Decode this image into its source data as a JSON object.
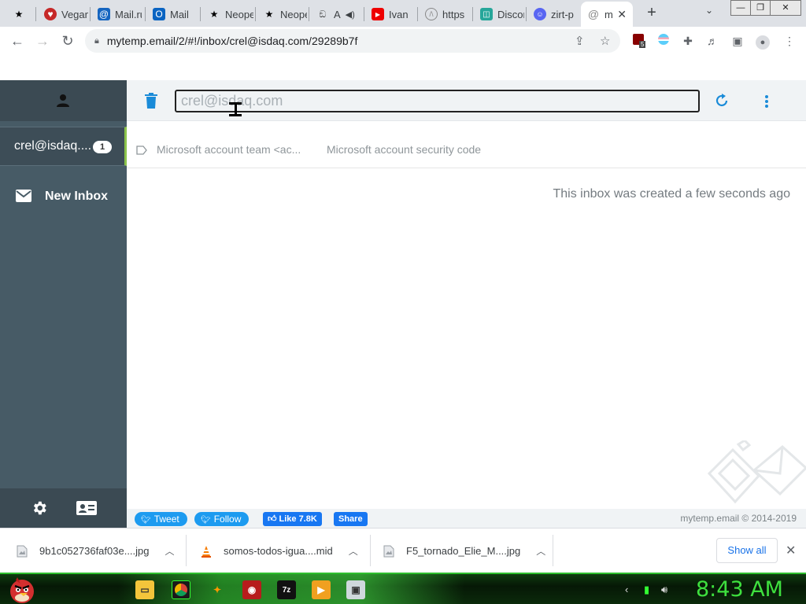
{
  "browser": {
    "tabs": [
      {
        "title": "",
        "icon": "star-icon"
      },
      {
        "title": "Vegan",
        "icon": "heart-icon"
      },
      {
        "title": "Mail.ru",
        "icon": "at-icon"
      },
      {
        "title": "Mail",
        "icon": "outlook-icon"
      },
      {
        "title": "Neopets",
        "icon": "star-icon"
      },
      {
        "title": "Neopets",
        "icon": "star-icon"
      },
      {
        "title": "A",
        "icon": "raccoon-icon"
      },
      {
        "title": "Ivan",
        "icon": "youtube-icon"
      },
      {
        "title": "https",
        "icon": "globe-icon"
      },
      {
        "title": "Discord",
        "icon": "doc-icon"
      },
      {
        "title": "zirt-p",
        "icon": "discord-icon"
      },
      {
        "title": "m",
        "icon": "at-icon"
      }
    ],
    "new_tab_symbol": "+",
    "url": "mytemp.email/2/#!/inbox/crel@isdaq.com/29289b7f",
    "extension_badge": "5"
  },
  "sidebar": {
    "inbox_address": "crel@isdaq....",
    "inbox_count": "1",
    "new_inbox_label": "New Inbox"
  },
  "main": {
    "address_placeholder": "crel@isdaq.com",
    "message": {
      "from": "Microsoft account team <ac...",
      "subject": "Microsoft account security code"
    },
    "created_text": "This inbox was created a few seconds ago"
  },
  "footer": {
    "tweet_label": "Tweet",
    "follow_label": "Follow",
    "like_label": "Like 7.8K",
    "share_label": "Share",
    "copyright": "mytemp.email © 2014-2019"
  },
  "downloads": {
    "items": [
      {
        "name": "9b1c052736faf03e....jpg"
      },
      {
        "name": "somos-todos-igua....mid"
      },
      {
        "name": "F5_tornado_Elie_M....jpg"
      }
    ],
    "show_all_label": "Show all"
  },
  "taskbar": {
    "clock": "8:43 AM"
  },
  "colors": {
    "sidebar": "#475b66",
    "accent": "#1a8bd8",
    "active_indicator": "#8bc34a",
    "clock": "#3ee03e"
  }
}
